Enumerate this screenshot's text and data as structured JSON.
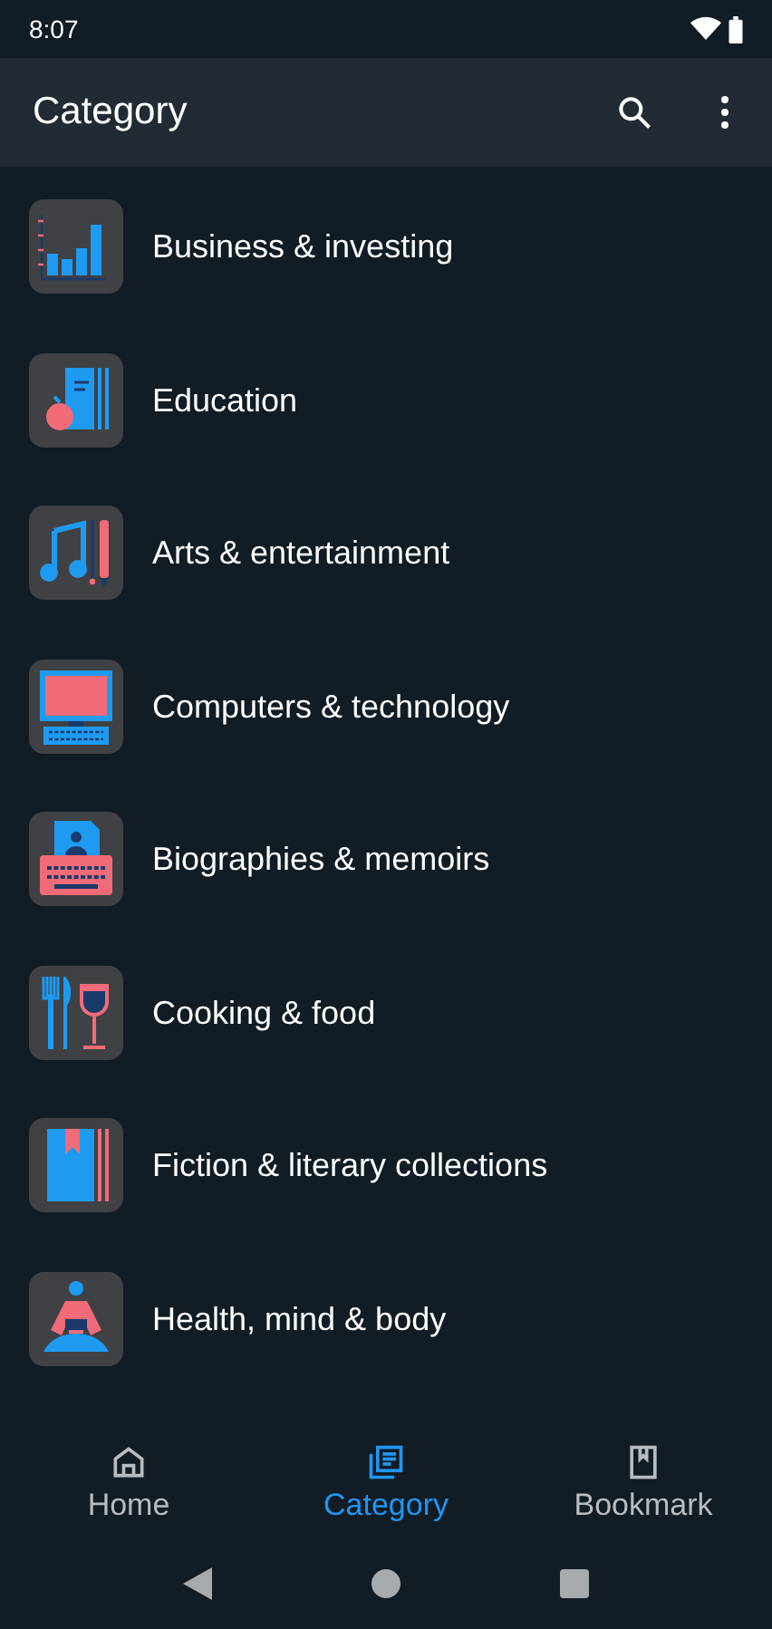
{
  "status_bar": {
    "time": "8:07"
  },
  "app_bar": {
    "title": "Category"
  },
  "categories": [
    {
      "label": "Business & investing",
      "kind": "chart"
    },
    {
      "label": "Education",
      "kind": "book-apple"
    },
    {
      "label": "Arts & entertainment",
      "kind": "music"
    },
    {
      "label": "Computers & technology",
      "kind": "computer"
    },
    {
      "label": "Biographies & memoirs",
      "kind": "typewriter"
    },
    {
      "label": "Cooking & food",
      "kind": "cutlery"
    },
    {
      "label": "Fiction & literary collections",
      "kind": "bookmark-book"
    },
    {
      "label": "Health, mind & body",
      "kind": "meditation"
    }
  ],
  "bottom_nav": [
    {
      "label": "Home",
      "kind": "home",
      "selected": false
    },
    {
      "label": "Category",
      "kind": "category",
      "selected": true
    },
    {
      "label": "Bookmark",
      "kind": "bookmark",
      "selected": false
    }
  ]
}
